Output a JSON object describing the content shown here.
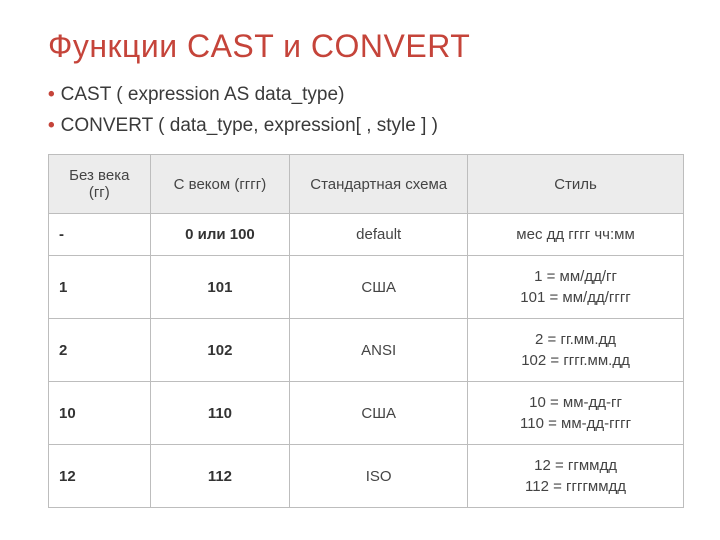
{
  "title": "Функции CAST и CONVERT",
  "bullets": [
    "CAST ( expression AS data_type)",
    "CONVERT ( data_type, expression[ , style ] )"
  ],
  "table": {
    "headers": [
      "Без века (гг)",
      "С веком (гггг)",
      "Стандартная схема",
      "Стиль"
    ],
    "rows": [
      {
        "c1": "-",
        "c2": "0 или 100",
        "c3": "default",
        "c4": "мес дд гггг чч:мм"
      },
      {
        "c1": "1",
        "c2": "101",
        "c3": "США",
        "c4": "1 = мм/дд/гг\n101 = мм/дд/гггг"
      },
      {
        "c1": "2",
        "c2": "102",
        "c3": "ANSI",
        "c4": "2 = гг.мм.дд\n102 = гггг.мм.дд"
      },
      {
        "c1": "10",
        "c2": "110",
        "c3": "США",
        "c4": "10 = мм-дд-гг\n110 = мм-дд-гггг"
      },
      {
        "c1": "12",
        "c2": "112",
        "c3": "ISO",
        "c4": "12 = ггммдд\n112 = ггггммдд"
      }
    ]
  }
}
